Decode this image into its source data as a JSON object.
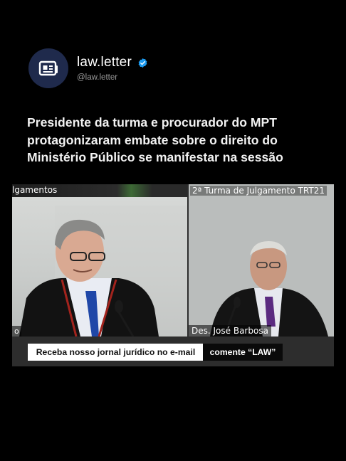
{
  "account": {
    "name": "law.letter",
    "handle": "@law.letter",
    "avatar_icon": "newspaper-icon",
    "verified_icon": "verified-badge-icon",
    "avatar_bg": "#1f2a4c",
    "verified_color": "#1d9bf0"
  },
  "post": {
    "headline": "Presidente da turma e procurador do MPT protagonizaram embate sobre o direito do Ministério Público se manifestar na sessão"
  },
  "video": {
    "left_panel_label": "lgamentos",
    "left_panel_bottom_label": "o",
    "right_panel_label": "2ª Turma de Julgamento TRT21",
    "right_panel_name": "Des. José Barbosa",
    "cta_left": "Receba nosso jornal jurídico no e-mail",
    "cta_right": "comente “LAW”"
  }
}
